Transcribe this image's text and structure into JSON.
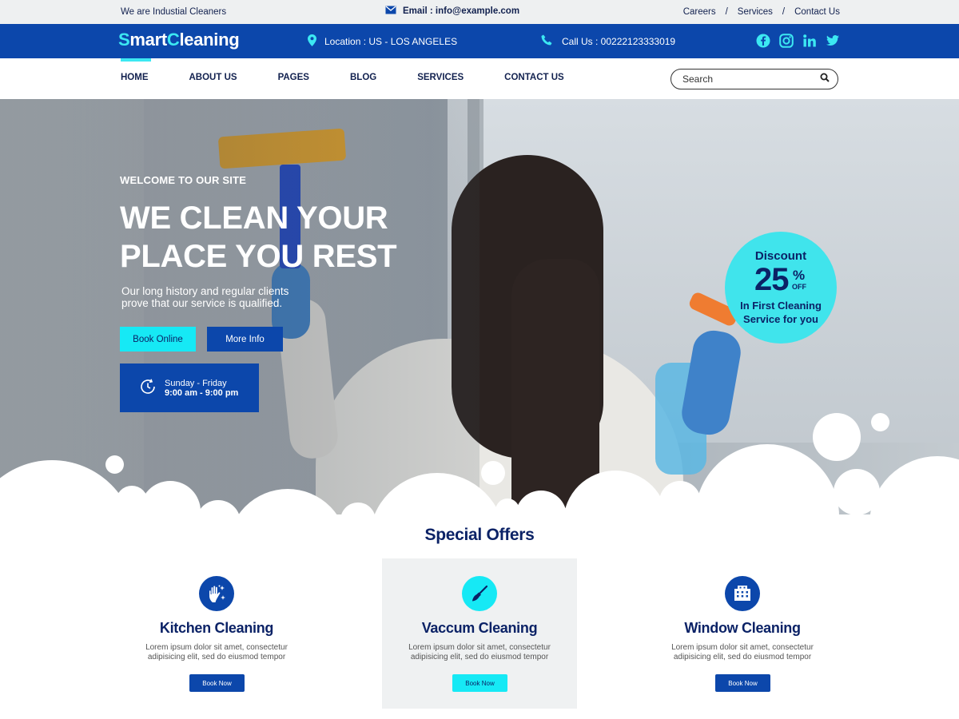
{
  "topbar": {
    "tagline": "We are Industial Cleaners",
    "email": "Email : info@example.com",
    "links": [
      "Careers",
      "Services",
      "Contact Us"
    ],
    "separator": "/"
  },
  "header": {
    "logo_first": "S",
    "logo_mid": "mart",
    "logo_c": "C",
    "logo_rest": "leaning",
    "location": "Location : US - LOS ANGELES",
    "call": "Call Us : 00222123333019",
    "social_icons": [
      "facebook-icon",
      "instagram-icon",
      "linkedin-icon",
      "twitter-icon"
    ]
  },
  "nav": {
    "items": [
      "HOME",
      "ABOUT US",
      "PAGES",
      "BLOG",
      "SERVICES",
      "CONTACT US"
    ],
    "active": "HOME",
    "search_placeholder": "Search"
  },
  "hero": {
    "welcome": "WELCOME TO OUR SITE",
    "headline_1": "WE CLEAN YOUR",
    "headline_2": "PLACE YOU REST",
    "sub": "Our long history and regular clients prove that our service is qualified.",
    "btn_book": "Book Online",
    "btn_more": "More Info",
    "hours_days": "Sunday - Friday",
    "hours_time": "9:00 am - 9:00 pm"
  },
  "discount": {
    "label": "Discount",
    "value": "25",
    "percent": "%",
    "off": "OFF",
    "desc_1": "In First Cleaning",
    "desc_2": "Service for you"
  },
  "offers": {
    "title": "Special Offers",
    "cards": [
      {
        "title": "Kitchen Cleaning",
        "text_1": "Lorem ipsum dolor sit amet, consectetur",
        "text_2": "adipisicing elit, sed do eiusmod tempor",
        "button": "Book Now"
      },
      {
        "title": "Vaccum Cleaning",
        "text_1": "Lorem ipsum dolor sit amet, consectetur",
        "text_2": "adipisicing elit, sed do eiusmod tempor",
        "button": "Book Now"
      },
      {
        "title": "Window Cleaning",
        "text_1": "Lorem ipsum dolor sit amet, consectetur",
        "text_2": "adipisicing elit, sed do eiusmod tempor",
        "button": "Book Now"
      }
    ]
  },
  "colors": {
    "brand_blue": "#0c47ab",
    "accent_cyan": "#16e9f5",
    "dark_navy": "#0b2266"
  }
}
